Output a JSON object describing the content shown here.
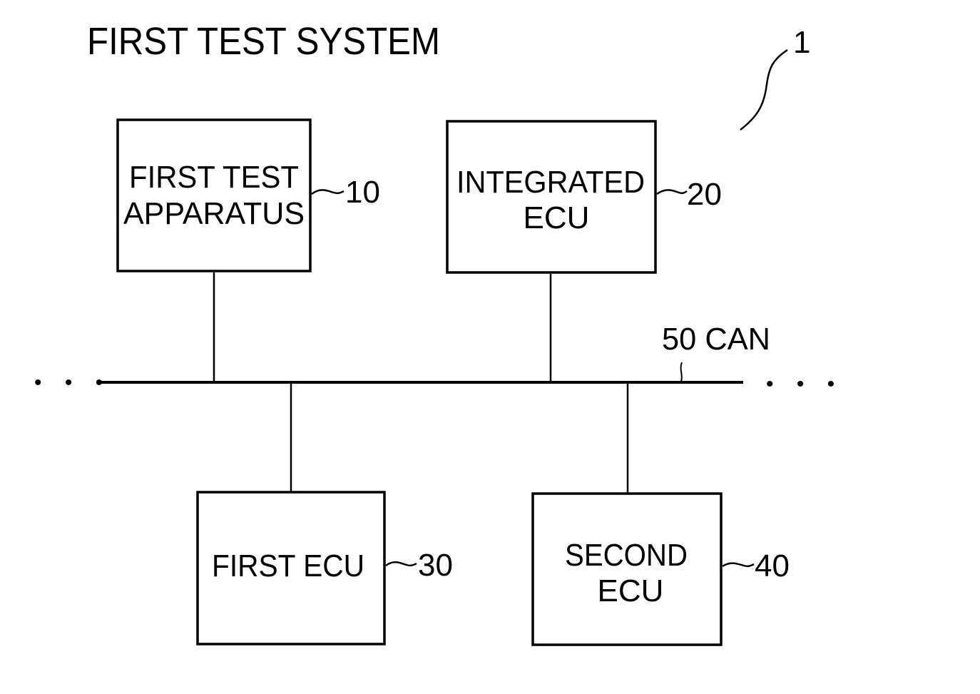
{
  "title": "FIRST TEST SYSTEM",
  "system_ref": "1",
  "blocks": [
    {
      "id": "first-test-apparatus",
      "lines": [
        "FIRST TEST",
        "APPARATUS"
      ],
      "ref": "10"
    },
    {
      "id": "integrated-ecu",
      "lines": [
        "INTEGRATED",
        "ECU"
      ],
      "ref": "20"
    },
    {
      "id": "first-ecu",
      "lines": [
        "FIRST ECU"
      ],
      "ref": "30"
    },
    {
      "id": "second-ecu",
      "lines": [
        "SECOND",
        "ECU"
      ],
      "ref": "40"
    }
  ],
  "bus": {
    "ref": "50",
    "label": "CAN",
    "text": "50 CAN",
    "continuation": "• • •"
  },
  "connections": [
    {
      "from": "first-test-apparatus",
      "to": "bus"
    },
    {
      "from": "integrated-ecu",
      "to": "bus"
    },
    {
      "from": "bus",
      "to": "first-ecu"
    },
    {
      "from": "bus",
      "to": "second-ecu"
    }
  ]
}
